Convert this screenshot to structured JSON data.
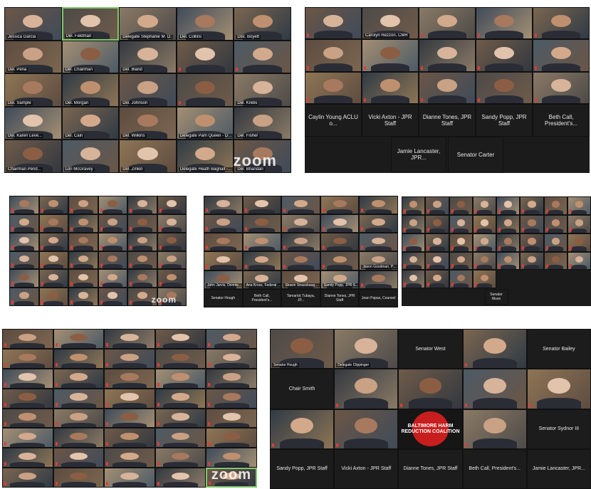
{
  "brand": "zoom",
  "colors": {
    "panel_bg": "#1b1b1b",
    "active_speaker": "#7ec96b",
    "mic_muted": "#e03b3b"
  },
  "panel1": {
    "tiles": [
      "Jessica Garcia",
      "Del. Feldman",
      "Delegate Stephanie M. D.",
      "Del. Collins",
      "Dist. Boyett",
      "Del. Pena",
      "Del. Chairman",
      "Del. Bland",
      "",
      "",
      "Del. Sample",
      "Del. Morgan",
      "Del. Johnson",
      "",
      "Del. Krebs",
      "Del. Karen Leve...",
      "Del. Cain",
      "Del. Wilkins",
      "Delegate Pam Queen - District 14",
      "Del. Fisher",
      "Chairman Pend...",
      "Lori McGravey",
      "Del. Zinkin",
      "Delegate Heath Bagnall - District 3",
      "Del. Bhandari"
    ]
  },
  "panel2": {
    "tiles": [
      "",
      "Carolyn Rezzon, CMR",
      "",
      "",
      "",
      "",
      "",
      "",
      "",
      "",
      "",
      "",
      "",
      "",
      "",
      "Caylin Young ACLU o...",
      "Vicki Axton - JPR Staff",
      "Dianne Tones, JPR Staff",
      "Sandy Popp, JPR Staff",
      "Beth Call, President's..."
    ],
    "bottom": [
      "Jamie Lancaster, JPR...",
      "Senator Carter"
    ]
  },
  "panel3": {
    "tiles": 36
  },
  "panel4": {
    "tiles": [
      "",
      "",
      "",
      "",
      "",
      "",
      "",
      "",
      "",
      "",
      "",
      "",
      "",
      "",
      "",
      "",
      "",
      "",
      "",
      "Jason Goodman, Presi...",
      "John Jarvis, Dennis P...",
      "Ana Kross, Federal Pl...",
      "Shawn Strassbaugh S...",
      "Sandy Popp, JPR Staff",
      "",
      "Senator Hough",
      "Beth Call, President's...",
      "Tamarick Tubaya, JP...",
      "Dianne Tones, JPR Staff",
      "Jean Papas, Counsel"
    ]
  },
  "panel5": {
    "tiles": 36,
    "extra": [
      "Senator Muse"
    ]
  },
  "panel6": {
    "tiles": 40
  },
  "panel7": {
    "row1": [
      "Senator Hough",
      "Delegate Clippinger",
      "Senator West",
      "",
      "Senator Bailey"
    ],
    "row2": [
      "Chair Smith",
      "",
      "",
      "",
      ""
    ],
    "row3": [
      "",
      "",
      "BALTIMORE HARM REDUCTION COALITION",
      "",
      "Senator Sydnor III"
    ],
    "row4": [
      "Sandy Popp, JPR Staff",
      "Vicki Axton - JPR Staff",
      "Dianne Tones, JPR Staff",
      "Beth Call, President's...",
      "Jamie Lancaster, JPR..."
    ]
  }
}
